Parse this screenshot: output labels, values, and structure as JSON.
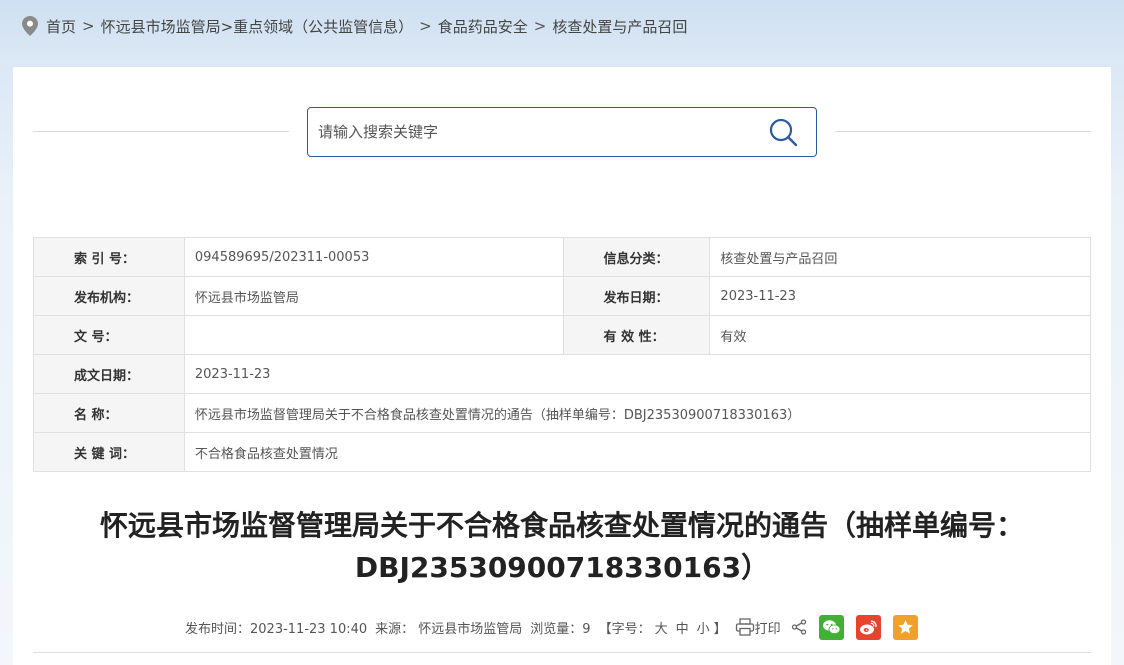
{
  "breadcrumb": {
    "items": [
      "首页",
      "怀远县市场监管局>重点领域（公共监管信息）",
      "食品药品安全",
      "核查处置与产品召回"
    ],
    "separator": ">"
  },
  "search": {
    "placeholder": "请输入搜索关键字"
  },
  "meta": {
    "index_label": "索 引 号：",
    "index_value": "094589695/202311-00053",
    "category_label": "信息分类：",
    "category_value": "核查处置与产品召回",
    "publisher_label": "发布机构：",
    "publisher_value": "怀远县市场监管局",
    "pubdate_label": "发布日期：",
    "pubdate_value": "2023-11-23",
    "docno_label": "文 号：",
    "docno_value": "",
    "validity_label": "有 效 性：",
    "validity_value": "有效",
    "created_label": "成文日期：",
    "created_value": "2023-11-23",
    "name_label": "名 称：",
    "name_value": "怀远县市场监督管理局关于不合格食品核查处置情况的通告（抽样单编号：DBJ23530900718330163）",
    "keywords_label": "关 键 词：",
    "keywords_value": "不合格食品核查处置情况"
  },
  "article": {
    "title_line1": "怀远县市场监督管理局关于不合格食品核查处置情况的通告（抽样单编号：",
    "title_line2": "DBJ23530900718330163）"
  },
  "info": {
    "publish_time": "发布时间：2023-11-23 10:40",
    "source": "来源： 怀远县市场监管局",
    "views": "浏览量：9",
    "fontsize_prefix": "【字号：",
    "fontsize_large": "大",
    "fontsize_medium": "中",
    "fontsize_small": "小",
    "fontsize_suffix": "】",
    "print_label": "打印"
  },
  "colors": {
    "accent": "#2c5aa0",
    "wechat": "#41b035",
    "weibo": "#e8432f",
    "favorite": "#f2a02c"
  },
  "icons": [
    "location-icon",
    "search-icon",
    "print-icon",
    "share-icon",
    "wechat-icon",
    "weibo-icon",
    "favorite-icon"
  ]
}
